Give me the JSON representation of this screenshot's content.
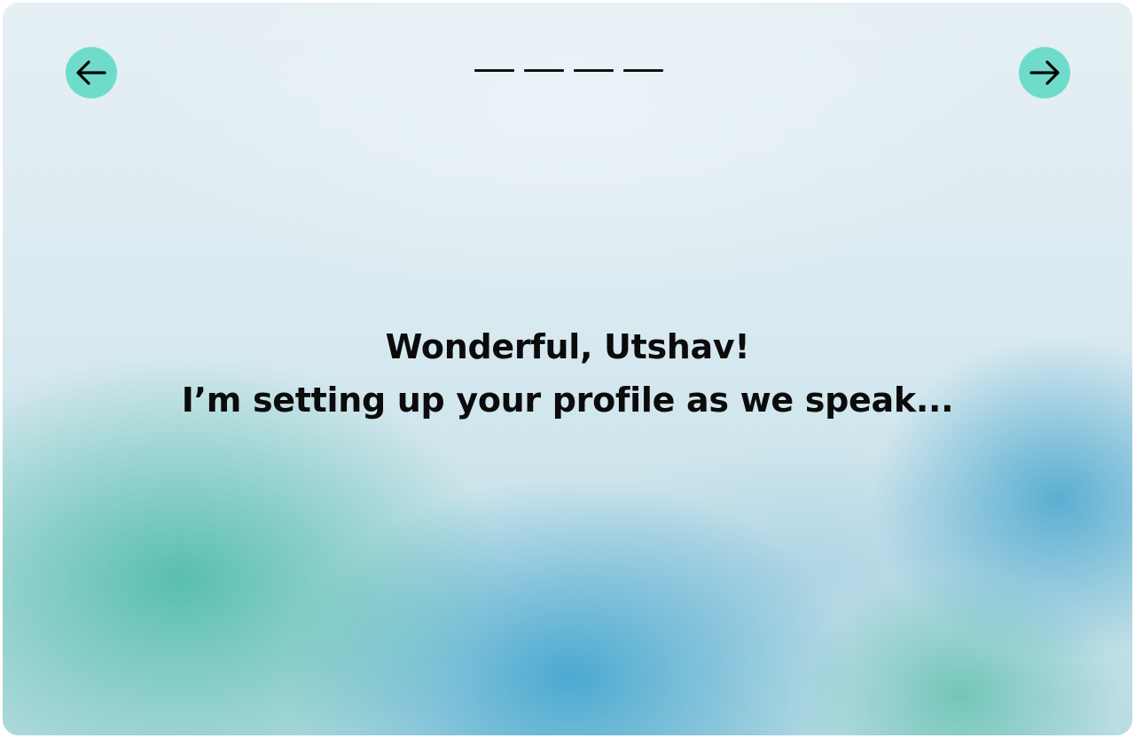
{
  "colors": {
    "accent": "#6fdccb",
    "text": "#0b0b0b",
    "progress": "#111111"
  },
  "navigation": {
    "back_icon": "arrow-left-icon",
    "next_icon": "arrow-right-icon"
  },
  "progress": {
    "steps": 4
  },
  "message": {
    "greeting": "Wonderful, Utshav!",
    "status": "I’m setting up your profile as we speak..."
  }
}
